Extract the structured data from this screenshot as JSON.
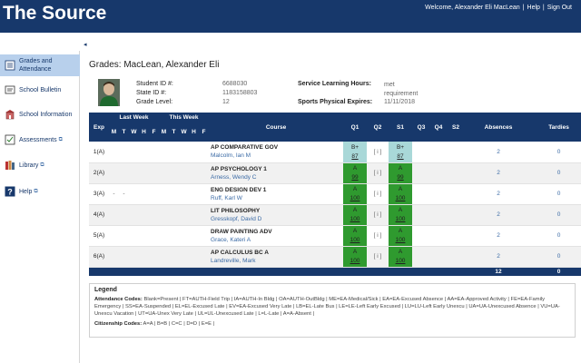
{
  "header": {
    "brand": "The Source",
    "welcome": "Welcome, Alexander Eli MacLean",
    "help": "Help",
    "sign_out": "Sign Out"
  },
  "sidebar": {
    "items": [
      {
        "label": "Grades and Attendance",
        "icon": "grades-icon",
        "active": true,
        "external": false
      },
      {
        "label": "School Bulletin",
        "icon": "bulletin-icon",
        "active": false,
        "external": false
      },
      {
        "label": "School Information",
        "icon": "school-icon",
        "active": false,
        "external": false
      },
      {
        "label": "Assessments",
        "icon": "assessments-icon",
        "active": false,
        "external": true
      },
      {
        "label": "Library",
        "icon": "library-icon",
        "active": false,
        "external": true
      },
      {
        "label": "Help",
        "icon": "help-icon",
        "active": false,
        "external": true
      }
    ],
    "external_glyph": "⧉"
  },
  "collapse_glyph": "◂",
  "page": {
    "title": "Grades: MacLean, Alexander Eli"
  },
  "student": {
    "student_id_label": "Student ID #:",
    "student_id": "6688030",
    "state_id_label": "State ID #:",
    "state_id": "1183158803",
    "grade_level_label": "Grade Level:",
    "grade_level": "12",
    "service_label": "Service Learning Hours:",
    "service_value": "met requirement",
    "physical_label": "Sports Physical Expires:",
    "physical_value": "11/11/2018"
  },
  "table": {
    "headers": {
      "exp": "Exp",
      "last_week": "Last Week",
      "this_week": "This Week",
      "days": [
        "M",
        "T",
        "W",
        "H",
        "F"
      ],
      "course": "Course",
      "q1": "Q1",
      "q2": "Q2",
      "s1": "S1",
      "q3": "Q3",
      "q4": "Q4",
      "s2": "S2",
      "absences": "Absences",
      "tardies": "Tardies"
    },
    "rows": [
      {
        "exp": "1(A)",
        "last": [
          "",
          "",
          "",
          "",
          ""
        ],
        "this": [
          "",
          "",
          "",
          "",
          ""
        ],
        "course": "AP COMPARATIVE GOV",
        "teacher": "Malcolm, Ian M",
        "q1_letter": "B+",
        "q1_pct": "87",
        "q1_color": "teal",
        "q2": "[ i ]",
        "s1_letter": "B+",
        "s1_pct": "87",
        "s1_color": "teal",
        "absences": "2",
        "tardies": "0"
      },
      {
        "exp": "2(A)",
        "last": [
          "",
          "",
          "",
          "",
          ""
        ],
        "this": [
          "",
          "",
          "",
          "",
          ""
        ],
        "course": "AP PSYCHOLOGY 1",
        "teacher": "Arness, Wendy C",
        "q1_letter": "A",
        "q1_pct": "99",
        "q1_color": "green",
        "q2": "[ i ]",
        "s1_letter": "A",
        "s1_pct": "99",
        "s1_color": "green",
        "absences": "2",
        "tardies": "0"
      },
      {
        "exp": "3(A)",
        "last": [
          "-",
          "-",
          "",
          "",
          ""
        ],
        "this": [
          "",
          "",
          "",
          "",
          ""
        ],
        "course": "ENG DESIGN DEV 1",
        "teacher": "Ruff, Karl W",
        "q1_letter": "A",
        "q1_pct": "100",
        "q1_color": "green",
        "q2": "[ i ]",
        "s1_letter": "A",
        "s1_pct": "100",
        "s1_color": "green",
        "absences": "2",
        "tardies": "0"
      },
      {
        "exp": "4(A)",
        "last": [
          "",
          "",
          "",
          "",
          ""
        ],
        "this": [
          "",
          "",
          "",
          "",
          ""
        ],
        "course": "LIT PHILOSOPHY",
        "teacher": "Gresskopf, David D",
        "q1_letter": "A",
        "q1_pct": "100",
        "q1_color": "green",
        "q2": "[ i ]",
        "s1_letter": "A",
        "s1_pct": "100",
        "s1_color": "green",
        "absences": "2",
        "tardies": "0"
      },
      {
        "exp": "5(A)",
        "last": [
          "",
          "",
          "",
          "",
          ""
        ],
        "this": [
          "",
          "",
          "",
          "",
          ""
        ],
        "course": "DRAW PAINTING ADV",
        "teacher": "Grace, Kateri A",
        "q1_letter": "A",
        "q1_pct": "100",
        "q1_color": "green",
        "q2": "[ i ]",
        "s1_letter": "A",
        "s1_pct": "100",
        "s1_color": "green",
        "absences": "2",
        "tardies": "0"
      },
      {
        "exp": "6(A)",
        "last": [
          "",
          "",
          "",
          "",
          ""
        ],
        "this": [
          "",
          "",
          "",
          "",
          ""
        ],
        "course": "AP CALCULUS BC A",
        "teacher": "Landreville, Mark",
        "q1_letter": "A",
        "q1_pct": "100",
        "q1_color": "green",
        "q2": "[ i ]",
        "s1_letter": "A",
        "s1_pct": "100",
        "s1_color": "green",
        "absences": "2",
        "tardies": "0"
      }
    ],
    "totals": {
      "absences": "12",
      "tardies": "0"
    }
  },
  "legend": {
    "title": "Legend",
    "attendance_label": "Attendance Codes:",
    "attendance_text": "Blank=Present | FT=AUTH-Field Trip | IA=AUTH-In Bldg | OA=AUTH-OutBldg | ME=EA-Medical/Sick | EA=EA-Excused Absence | AA=EA-Approved Activity | FE=EA-Family Emergency | SS=EA-Suspended | EL=EL-Excused Late | EV=EA-Excused Very Late | LB=EL-Late Bus | LE=LE-Left Early Excused | LU=LU-Left Early Unexcu | UA=UA-Unexcused Absence | VU=UA-Unexcu Vacation | UT=UA-Unex Very Late | UL=UL-Unexcused Late | L=L-Late | A=A-Absent |",
    "citizenship_label": "Citizenship Codes:",
    "citizenship_text": "A=A | B=B | C=C | D=D | E=E |"
  },
  "colors": {
    "header_bg": "#17386b",
    "active_nav_bg": "#b8d0ec",
    "grade_teal": "#a9d8d8",
    "grade_green": "#2f9a2f",
    "link": "#3a6aa5"
  }
}
